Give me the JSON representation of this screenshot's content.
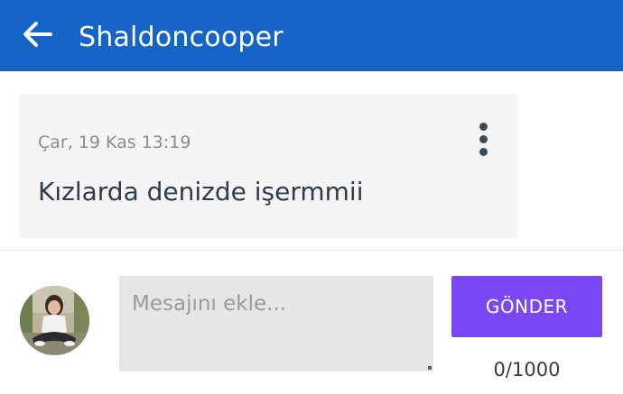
{
  "header": {
    "title": "Shaldoncooper",
    "back_icon": "arrow-left-icon",
    "background_color": "#1565c8"
  },
  "message": {
    "timestamp": "Çar, 19 Kas 13:19",
    "text": "Kızlarda denizde işermmii",
    "menu_icon": "more-vertical-icon"
  },
  "composer": {
    "avatar_icon": "user-avatar",
    "input_value": "",
    "input_placeholder": "Mesajını ekle...",
    "send_label": "GÖNDER",
    "send_color": "#7a47f5",
    "char_count": "0/1000"
  }
}
